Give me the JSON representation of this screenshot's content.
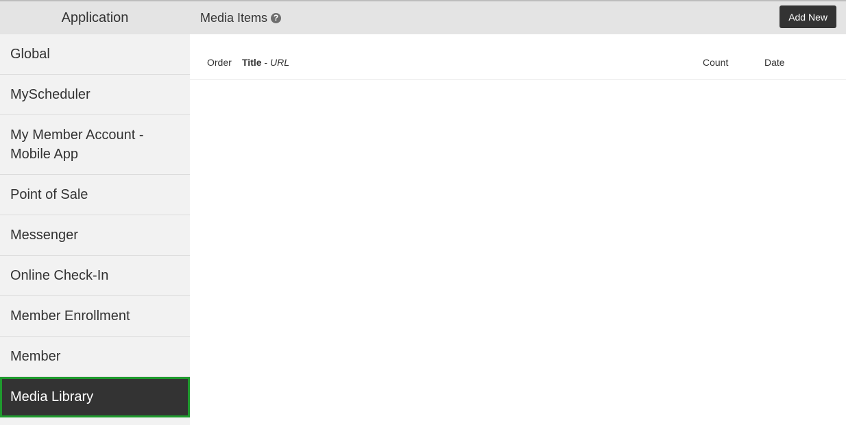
{
  "sidebar": {
    "header": "Application",
    "items": [
      {
        "label": "Global"
      },
      {
        "label": "MyScheduler"
      },
      {
        "label": "My Member Account - Mobile App"
      },
      {
        "label": "Point of Sale"
      },
      {
        "label": "Messenger"
      },
      {
        "label": "Online Check-In"
      },
      {
        "label": "Member Enrollment"
      },
      {
        "label": "Member"
      },
      {
        "label": "Media Library",
        "active": true
      }
    ]
  },
  "topbar": {
    "title": "Media Items",
    "help_icon": "question-circle-icon",
    "add_button": "Add New"
  },
  "table": {
    "columns": {
      "order": "Order",
      "title": "Title",
      "title_separator": " - ",
      "url": "URL",
      "count": "Count",
      "date": "Date"
    },
    "rows": []
  },
  "colors": {
    "sidebar_bg": "#f2f2f2",
    "header_bg": "#e4e4e4",
    "active_bg": "#333333",
    "active_border": "#1f9a2e",
    "button_bg": "#333333"
  }
}
